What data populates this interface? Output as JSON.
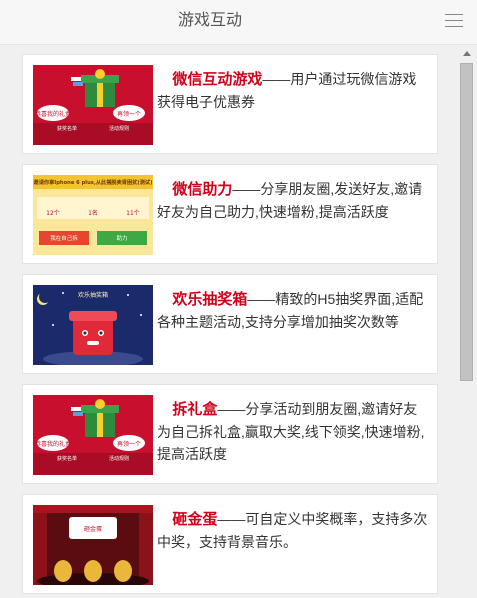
{
  "header": {
    "title": "游戏互动",
    "menu_icon": "hamburger-menu-icon"
  },
  "items": [
    {
      "title": "微信互动游戏",
      "text": "——用户通过玩微信游戏获得电子优惠券"
    },
    {
      "title": "微信助力",
      "text": "——分享朋友圈,发送好友,邀请好友为自己助力,快速增粉,提高活跃度"
    },
    {
      "title": "欢乐抽奖箱",
      "text": "——精致的H5抽奖界面,适配各种主题活动,支持分享增加抽奖次数等"
    },
    {
      "title": "拆礼盒",
      "text": "——分享活动到朋友圈,邀请好友为自己拆礼盒,赢取大奖,线下领奖,快速增粉,提高活跃度"
    },
    {
      "title": "砸金蛋",
      "text": "——可自定义中奖概率，支持多次中奖，支持背景音乐。"
    }
  ],
  "thumbs": {
    "gift": {
      "left_label": "恭喜我的礼盒",
      "right_label": "再领一个",
      "link1": "获奖名单",
      "link2": "活动规则"
    },
    "assist": {
      "title": "邀请你拿Iphone 6 plus,从此摆脱卖肾困扰(测试)",
      "stats": [
        "12个",
        "1名",
        "11个"
      ],
      "btn1": "我在自己拆",
      "btn2": "助力"
    },
    "lottery": {
      "title": "欢乐抽奖箱"
    },
    "egg": {
      "banner": "砸金蛋"
    }
  },
  "colors": {
    "accent": "#d0021b"
  }
}
